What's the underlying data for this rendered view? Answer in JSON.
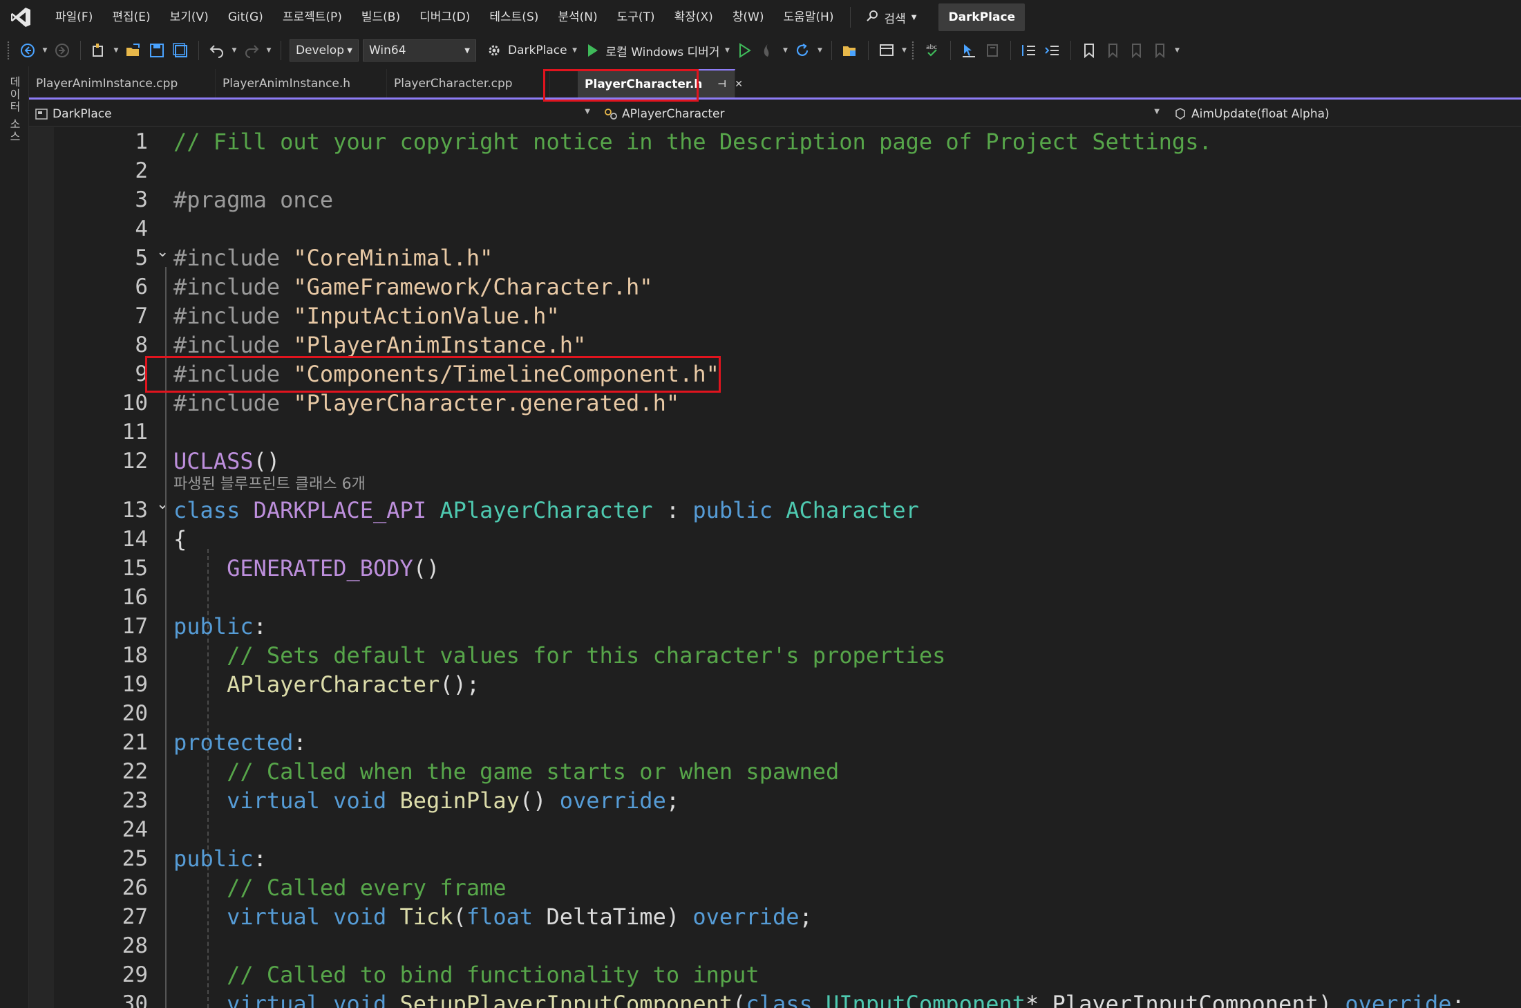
{
  "menu": {
    "items": [
      "파일(F)",
      "편집(E)",
      "보기(V)",
      "Git(G)",
      "프로젝트(P)",
      "빌드(B)",
      "디버그(D)",
      "테스트(S)",
      "분석(N)",
      "도구(T)",
      "확장(X)",
      "창(W)",
      "도움말(H)"
    ],
    "search_label": "검색",
    "solution_name": "DarkPlace"
  },
  "toolbar": {
    "config": "Develop",
    "platform": "Win64",
    "startup_project": "DarkPlace",
    "debugger": "로컬 Windows 디버거"
  },
  "left_rail": {
    "label": "데이터 소스"
  },
  "tabs": [
    {
      "label": "PlayerAnimInstance.cpp",
      "active": false
    },
    {
      "label": "PlayerAnimInstance.h",
      "active": false
    },
    {
      "label": "PlayerCharacter.cpp",
      "active": false
    },
    {
      "label": "PlayerCharacter.h",
      "active": true
    }
  ],
  "navbar": {
    "project": "DarkPlace",
    "scope": "APlayerCharacter",
    "member": "AimUpdate(float Alpha)"
  },
  "editor": {
    "inlay_hint": "파생된 블루프린트 클래스 6개",
    "lines": [
      {
        "n": "1",
        "tokens": [
          [
            "c-comment",
            "// Fill out your copyright notice in the Description page of Project Settings."
          ]
        ]
      },
      {
        "n": "2",
        "tokens": []
      },
      {
        "n": "3",
        "tokens": [
          [
            "c-pre",
            "#pragma once"
          ]
        ]
      },
      {
        "n": "4",
        "tokens": []
      },
      {
        "n": "5",
        "tokens": [
          [
            "c-pre",
            "#include "
          ],
          [
            "c-str",
            "\"CoreMinimal.h\""
          ]
        ]
      },
      {
        "n": "6",
        "tokens": [
          [
            "c-pre",
            "#include "
          ],
          [
            "c-str",
            "\"GameFramework/Character.h\""
          ]
        ]
      },
      {
        "n": "7",
        "tokens": [
          [
            "c-pre",
            "#include "
          ],
          [
            "c-str",
            "\"InputActionValue.h\""
          ]
        ]
      },
      {
        "n": "8",
        "tokens": [
          [
            "c-pre",
            "#include "
          ],
          [
            "c-str",
            "\"PlayerAnimInstance.h\""
          ]
        ]
      },
      {
        "n": "9",
        "tokens": [
          [
            "c-pre",
            "#include "
          ],
          [
            "c-str",
            "\"Components/TimelineComponent.h\""
          ]
        ]
      },
      {
        "n": "10",
        "tokens": [
          [
            "c-pre",
            "#include "
          ],
          [
            "c-str",
            "\"PlayerCharacter.generated.h\""
          ]
        ]
      },
      {
        "n": "11",
        "tokens": []
      },
      {
        "n": "12",
        "tokens": [
          [
            "c-macro",
            "UCLASS"
          ],
          [
            "c-plain",
            "()"
          ]
        ]
      },
      {
        "n": "13",
        "tokens": [
          [
            "c-kw",
            "class "
          ],
          [
            "c-macro",
            "DARKPLACE_API "
          ],
          [
            "c-type",
            "APlayerCharacter"
          ],
          [
            "c-plain",
            " : "
          ],
          [
            "c-kw",
            "public "
          ],
          [
            "c-type",
            "ACharacter"
          ]
        ]
      },
      {
        "n": "14",
        "tokens": [
          [
            "c-plain",
            "{"
          ]
        ]
      },
      {
        "n": "15",
        "tokens": [
          [
            "c-plain",
            "    "
          ],
          [
            "c-macro",
            "GENERATED_BODY"
          ],
          [
            "c-plain",
            "()"
          ]
        ]
      },
      {
        "n": "16",
        "tokens": []
      },
      {
        "n": "17",
        "tokens": [
          [
            "c-kw",
            "public"
          ],
          [
            "c-plain",
            ":"
          ]
        ]
      },
      {
        "n": "18",
        "tokens": [
          [
            "c-plain",
            "    "
          ],
          [
            "c-comment",
            "// Sets default values for this character's properties"
          ]
        ]
      },
      {
        "n": "19",
        "tokens": [
          [
            "c-plain",
            "    "
          ],
          [
            "c-func",
            "APlayerCharacter"
          ],
          [
            "c-plain",
            "();"
          ]
        ]
      },
      {
        "n": "20",
        "tokens": []
      },
      {
        "n": "21",
        "tokens": [
          [
            "c-kw",
            "protected"
          ],
          [
            "c-plain",
            ":"
          ]
        ]
      },
      {
        "n": "22",
        "tokens": [
          [
            "c-plain",
            "    "
          ],
          [
            "c-comment",
            "// Called when the game starts or when spawned"
          ]
        ]
      },
      {
        "n": "23",
        "tokens": [
          [
            "c-plain",
            "    "
          ],
          [
            "c-kw",
            "virtual void "
          ],
          [
            "c-func",
            "BeginPlay"
          ],
          [
            "c-plain",
            "() "
          ],
          [
            "c-kw",
            "override"
          ],
          [
            "c-plain",
            ";"
          ]
        ]
      },
      {
        "n": "24",
        "tokens": []
      },
      {
        "n": "25",
        "tokens": [
          [
            "c-kw",
            "public"
          ],
          [
            "c-plain",
            ":"
          ]
        ]
      },
      {
        "n": "26",
        "tokens": [
          [
            "c-plain",
            "    "
          ],
          [
            "c-comment",
            "// Called every frame"
          ]
        ]
      },
      {
        "n": "27",
        "tokens": [
          [
            "c-plain",
            "    "
          ],
          [
            "c-kw",
            "virtual void "
          ],
          [
            "c-func",
            "Tick"
          ],
          [
            "c-plain",
            "("
          ],
          [
            "c-kw",
            "float "
          ],
          [
            "c-plain",
            "DeltaTime) "
          ],
          [
            "c-kw",
            "override"
          ],
          [
            "c-plain",
            ";"
          ]
        ]
      },
      {
        "n": "28",
        "tokens": []
      },
      {
        "n": "29",
        "tokens": [
          [
            "c-plain",
            "    "
          ],
          [
            "c-comment",
            "// Called to bind functionality to input"
          ]
        ]
      },
      {
        "n": "30",
        "tokens": [
          [
            "c-plain",
            "    "
          ],
          [
            "c-kw",
            "virtual void "
          ],
          [
            "c-func",
            "SetupPlayerInputComponent"
          ],
          [
            "c-plain",
            "("
          ],
          [
            "c-kw",
            "class "
          ],
          [
            "c-type",
            "UInputComponent"
          ],
          [
            "c-plain",
            "* PlayerInputComponent) "
          ],
          [
            "c-kw",
            "override"
          ],
          [
            "c-plain",
            ";"
          ]
        ]
      }
    ]
  },
  "colors": {
    "accent": "#8d7cf5",
    "highlight": "#e0141e",
    "comment": "#57a64a",
    "string": "#e8c9a5",
    "keyword": "#569cd6",
    "type": "#4ec9b0"
  }
}
